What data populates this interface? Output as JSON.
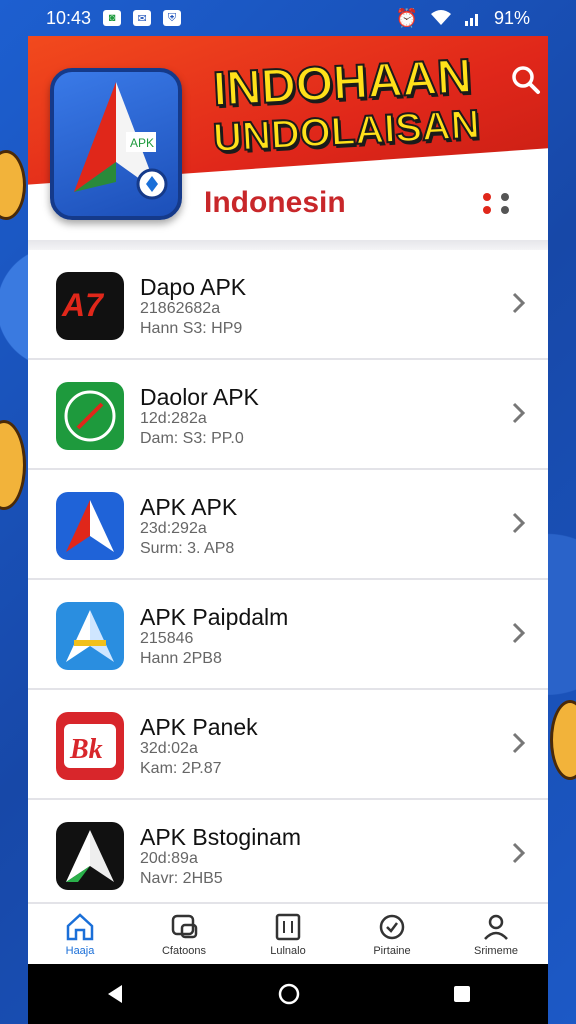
{
  "status_bar": {
    "time": "10:43",
    "battery": "91%"
  },
  "header": {
    "brand_line1": "INDOHAAN",
    "brand_line2": "UNDOLAISAN",
    "subtitle": "Indonesin"
  },
  "apps": [
    {
      "title": "Dapo APK",
      "line2": "21862682a",
      "line3": "Hann S3: HP9",
      "icon_color": "#111111",
      "icon_text": "A7"
    },
    {
      "title": "Daolor APK",
      "line2": "12d:282a",
      "line3": "Dam: S3: PP.0",
      "icon_color": "#1e9a3d",
      "icon_text": ""
    },
    {
      "title": "APK APK",
      "line2": "23d:292a",
      "line3": "Surm: 3. AP8",
      "icon_color": "#1f63d8",
      "icon_text": "A"
    },
    {
      "title": "APK Paipdalm",
      "line2": "215846",
      "line3": "Hann 2PB8",
      "icon_color": "#2a8ee0",
      "icon_text": "A"
    },
    {
      "title": "APK Panek",
      "line2": "32d:02a",
      "line3": "Kam: 2P.87",
      "icon_color": "#d8262b",
      "icon_text": "Bk"
    },
    {
      "title": "APK Bstoginam",
      "line2": "20d:89a",
      "line3": "Navr: 2HB5",
      "icon_color": "#111111",
      "icon_text": "A"
    }
  ],
  "bottom_nav": [
    {
      "label": "Haaja",
      "icon": "home-icon",
      "active": true
    },
    {
      "label": "Cfatoons",
      "icon": "chat-icon",
      "active": false
    },
    {
      "label": "Lulnalo",
      "icon": "book-icon",
      "active": false
    },
    {
      "label": "Pirtaine",
      "icon": "clock-icon",
      "active": false
    },
    {
      "label": "Srimeme",
      "icon": "profile-icon",
      "active": false
    }
  ],
  "colors": {
    "accent_red": "#e0271a",
    "brand_yellow": "#ffe11a",
    "nav_active": "#1a6fd8"
  }
}
